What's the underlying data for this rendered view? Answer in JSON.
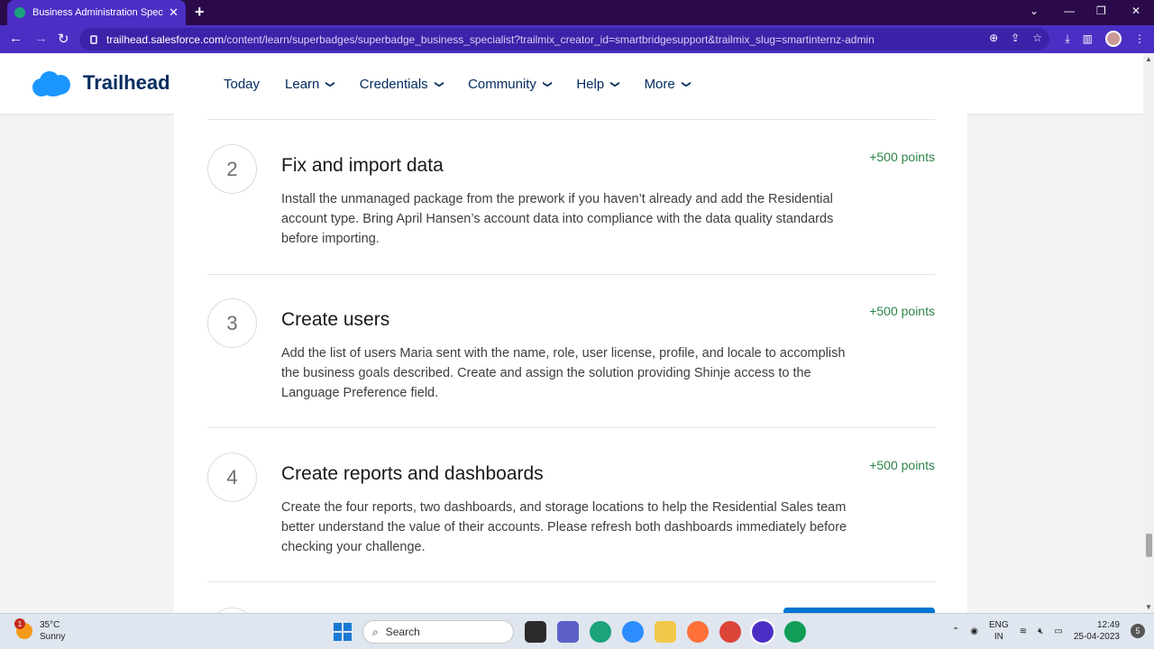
{
  "browser": {
    "tab_title": "Business Administration Specialist",
    "new_tab": "+",
    "url_host": "trailhead.salesforce.com",
    "url_path": "/content/learn/superbadges/superbadge_business_specialist?trailmix_creator_id=smartbridgesupport&trailmix_slug=smartinternz-admin"
  },
  "header": {
    "brand": "Trailhead",
    "nav": [
      {
        "label": "Today",
        "dropdown": false
      },
      {
        "label": "Learn",
        "dropdown": true
      },
      {
        "label": "Credentials",
        "dropdown": true
      },
      {
        "label": "Community",
        "dropdown": true
      },
      {
        "label": "Help",
        "dropdown": true
      },
      {
        "label": "More",
        "dropdown": true
      }
    ]
  },
  "steps": [
    {
      "number": "2",
      "title": "Fix and import data",
      "points": "+500 points",
      "description": "Install the unmanaged package from the prework if you haven’t already and add the Residential account type. Bring April Hansen’s account data into compliance with the data quality standards before importing."
    },
    {
      "number": "3",
      "title": "Create users",
      "points": "+500 points",
      "description": "Add the list of users Maria sent with the name, role, user license, profile, and locale to accomplish the business goals described. Create and assign the solution providing Shinje access to the Language Preference field."
    },
    {
      "number": "4",
      "title": "Create reports and dashboards",
      "points": "+500 points",
      "description": "Create the four reports, two dashboards, and storage locations to help the Residential Sales team better understand the value of their accounts. Please refresh both dashboards immediately before checking your challenge."
    }
  ],
  "taskbar": {
    "weather_temp": "35°C",
    "weather_desc": "Sunny",
    "weather_badge": "1",
    "search_placeholder": "Search",
    "lang_top": "ENG",
    "lang_bottom": "IN",
    "time": "12:49",
    "date": "25-04-2023",
    "notifications": "5"
  },
  "colors": {
    "browser_accent": "#4b2fc4",
    "brand_blue": "#032d60",
    "points_green": "#2e844a",
    "primary_button": "#0176d3"
  }
}
